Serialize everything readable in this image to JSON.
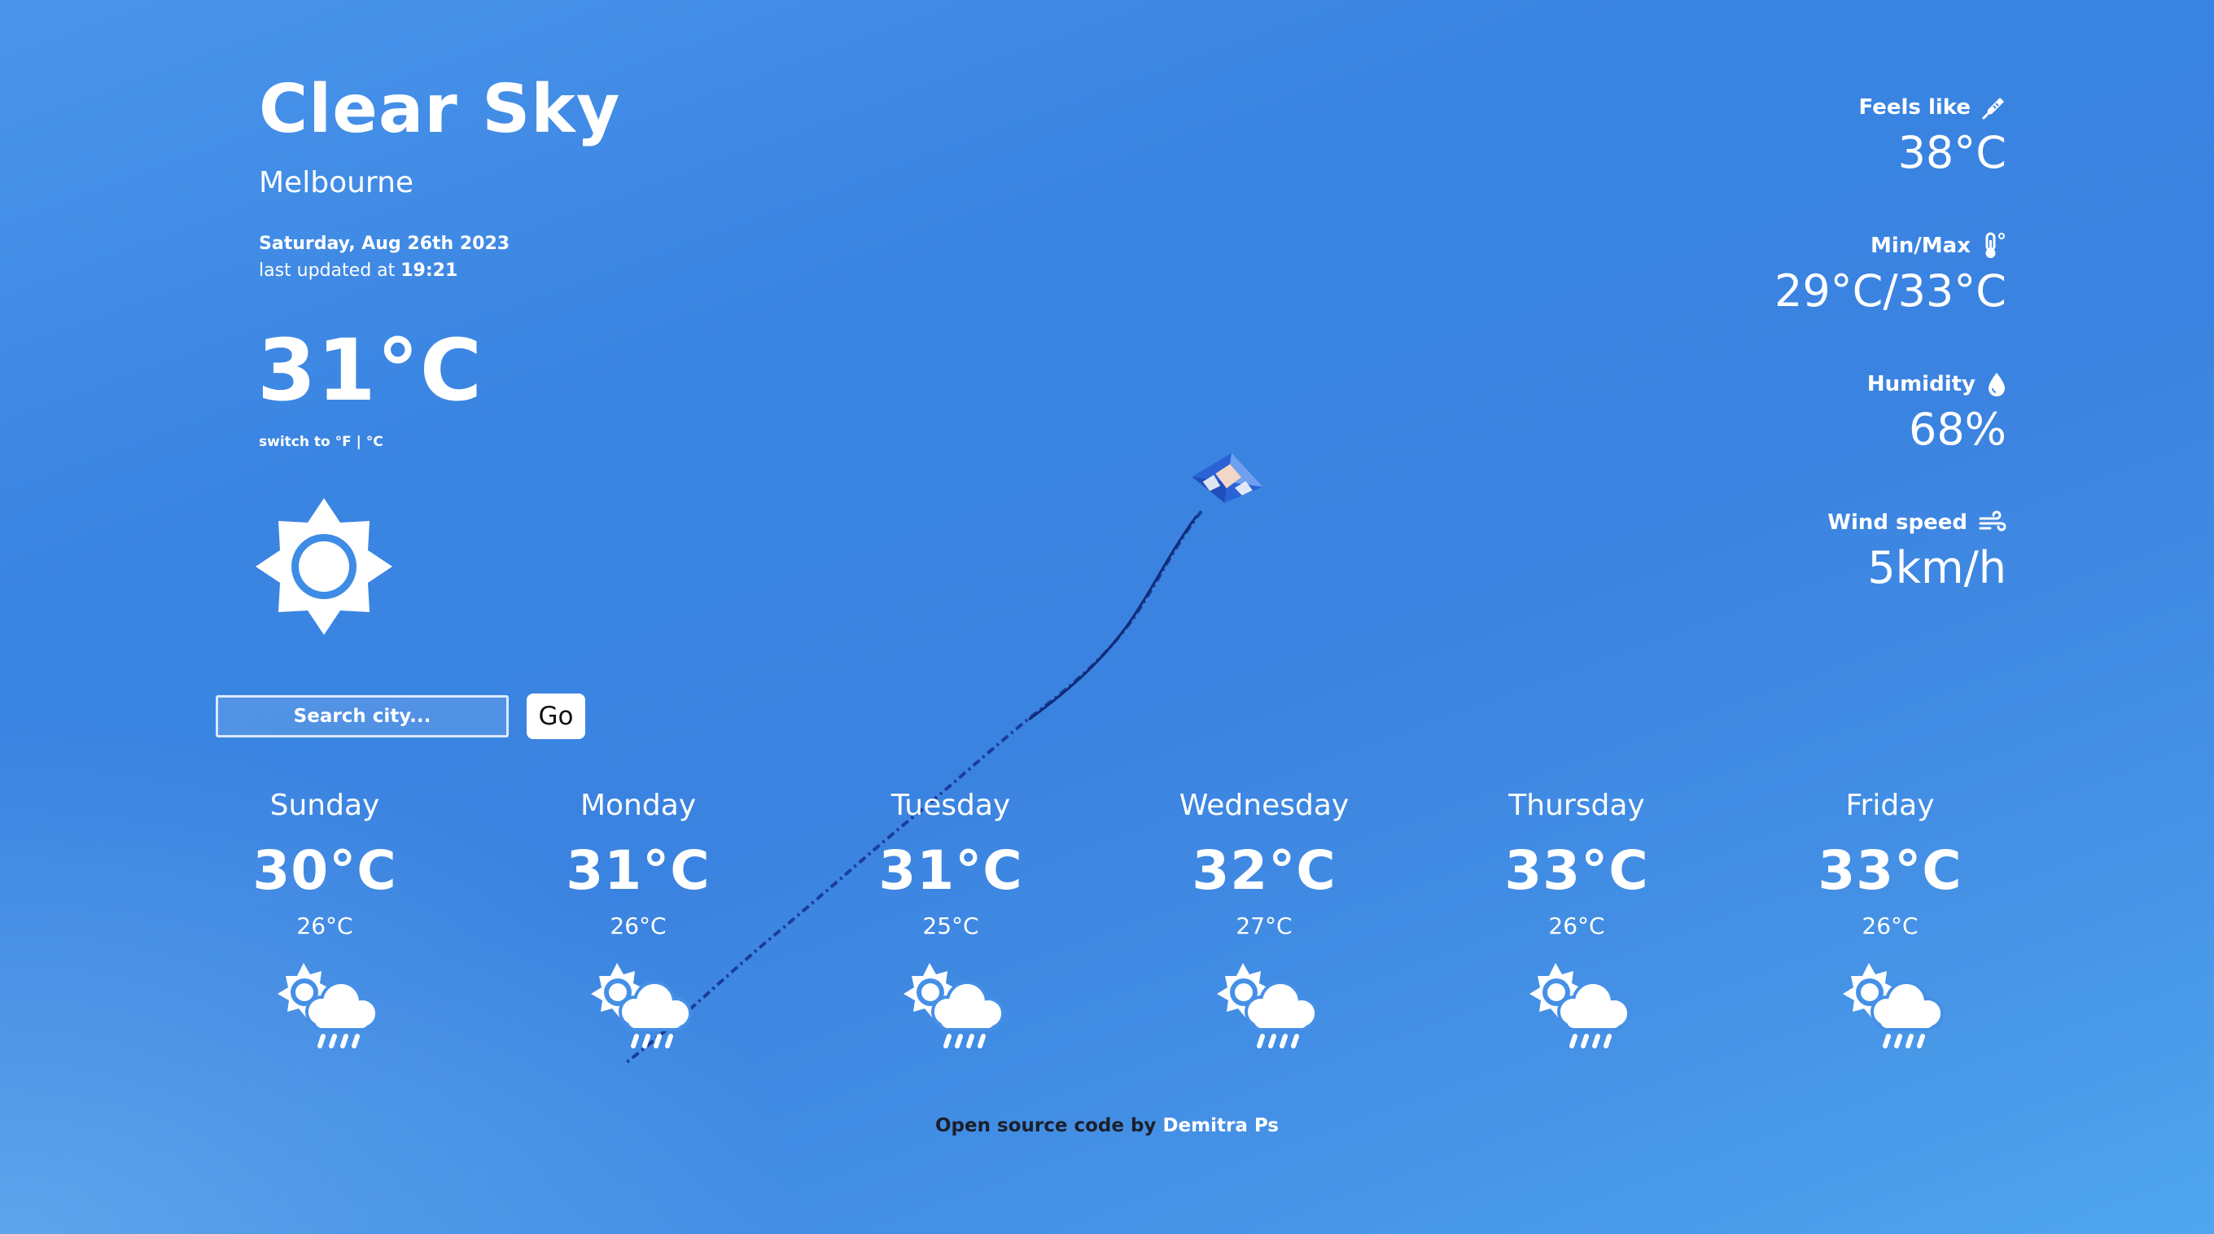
{
  "current": {
    "condition": "Clear Sky",
    "city": "Melbourne",
    "date": "Saturday, Aug 26th 2023",
    "updated_prefix": "last updated at ",
    "updated_time": "19:21",
    "temperature": "31°C",
    "unit_switch": "switch to °F | °C",
    "icon": "sun-icon"
  },
  "search": {
    "placeholder": "Search city...",
    "button_label": "Go"
  },
  "stats": {
    "feels_like": {
      "label": "Feels like",
      "value": "38°C",
      "icon": "thermometer-pen-icon"
    },
    "min_max": {
      "label": "Min/Max",
      "value": "29°C/33°C",
      "icon": "thermometer-icon"
    },
    "humidity": {
      "label": "Humidity",
      "value": "68%",
      "icon": "droplet-icon"
    },
    "wind": {
      "label": "Wind speed",
      "value": "5km/h",
      "icon": "wind-icon"
    }
  },
  "forecast": [
    {
      "day": "Sunday",
      "max": "30°C",
      "min": "26°C",
      "icon": "sun-cloud-rain-icon"
    },
    {
      "day": "Monday",
      "max": "31°C",
      "min": "26°C",
      "icon": "sun-cloud-rain-icon"
    },
    {
      "day": "Tuesday",
      "max": "31°C",
      "min": "25°C",
      "icon": "sun-cloud-rain-icon"
    },
    {
      "day": "Wednesday",
      "max": "32°C",
      "min": "27°C",
      "icon": "sun-cloud-rain-icon"
    },
    {
      "day": "Thursday",
      "max": "33°C",
      "min": "26°C",
      "icon": "sun-cloud-rain-icon"
    },
    {
      "day": "Friday",
      "max": "33°C",
      "min": "26°C",
      "icon": "sun-cloud-rain-icon"
    }
  ],
  "footer": {
    "link_text": "Open source code",
    "by_text": " by ",
    "author": "Demitra Ps"
  }
}
